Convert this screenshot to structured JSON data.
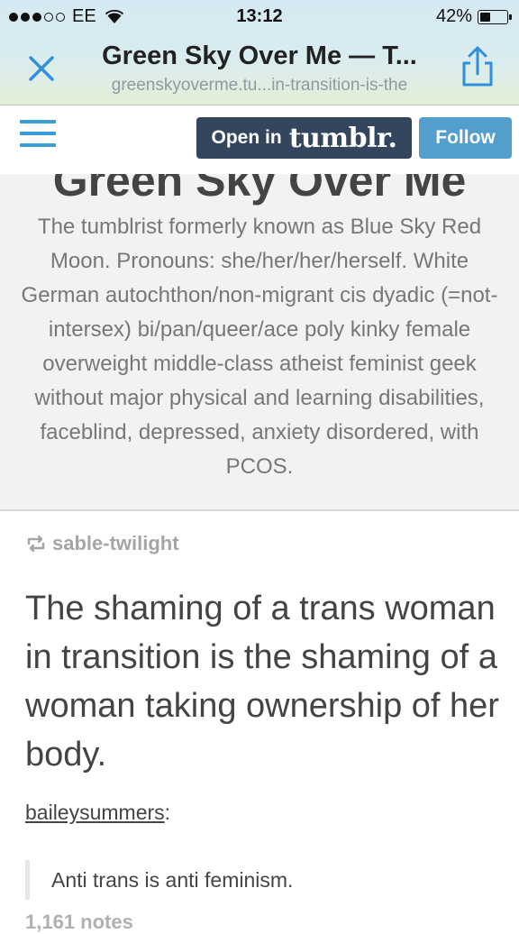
{
  "status_bar": {
    "carrier": "EE",
    "time": "13:12",
    "battery_percent": "42%",
    "battery_level": 0.42,
    "signal_bars_filled": 3,
    "signal_bars_total": 5
  },
  "browser": {
    "page_title": "Green Sky Over Me — T...",
    "url": "greenskyoverme.tu...in-transition-is-the",
    "close_icon": "close-x-icon",
    "share_icon": "share-icon"
  },
  "tumblr_bar": {
    "open_in_label": "Open in",
    "brand": "tumblr.",
    "follow_label": "Follow",
    "accent": "#529ecc",
    "navy": "#34465d"
  },
  "blog": {
    "title": "Green Sky Over Me",
    "description": "The tumblrist formerly known as Blue Sky Red Moon. Pronouns: she/her/her/herself. White German autochthon/non-migrant cis dyadic (=not-intersex) bi/pan/queer/ace poly kinky female overweight middle-class atheist feminist geek without major physical and learning disabilities, faceblind, depressed, anxiety disordered, with PCOS."
  },
  "post": {
    "reblogged_from": "sable-twilight",
    "title": "The shaming of a trans woman in transition is the shaming of a woman taking ownership of her body.",
    "source_user": "baileysummers",
    "source_suffix": ":",
    "quote": "Anti trans is anti feminism.",
    "notes": "1,161 notes"
  }
}
